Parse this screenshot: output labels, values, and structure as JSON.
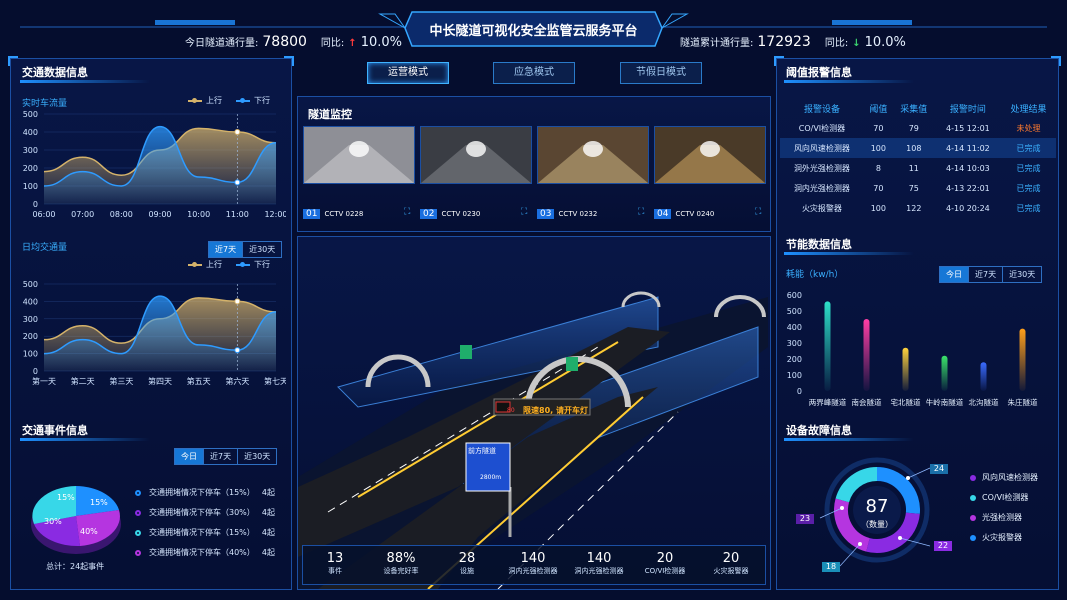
{
  "header": {
    "title": "中长隧道可视化安全监管云服务平台",
    "today_label": "今日隧道通行量:",
    "today_value": "78800",
    "today_yoy_label": "同比:",
    "today_yoy_arrow": "↑",
    "today_yoy_value": "10.0%",
    "total_label": "隧道累计通行量:",
    "total_value": "172923",
    "total_yoy_label": "同比:",
    "total_yoy_arrow": "↓",
    "total_yoy_value": "10.0%",
    "colors": {
      "up": "#ff3b3b",
      "down": "#3bd16f"
    }
  },
  "modes": [
    {
      "label": "运营模式",
      "active": true
    },
    {
      "label": "应急模式",
      "active": false
    },
    {
      "label": "节假日模式",
      "active": false
    }
  ],
  "traffic_info": {
    "title": "交通数据信息",
    "realtime": {
      "label": "实时车流量",
      "legend_up": "上行",
      "legend_down": "下行",
      "y_ticks": [
        "500",
        "400",
        "300",
        "200",
        "100",
        "0"
      ],
      "x_ticks": [
        "06:00",
        "07:00",
        "08:00",
        "09:00",
        "10:00",
        "11:00",
        "12:00"
      ]
    },
    "daily": {
      "label": "日均交通量",
      "tabs": [
        "近7天",
        "近30天"
      ],
      "legend_up": "上行",
      "legend_down": "下行",
      "y_ticks": [
        "500",
        "400",
        "300",
        "200",
        "100",
        "0"
      ],
      "x_ticks": [
        "第一天",
        "第二天",
        "第三天",
        "第四天",
        "第五天",
        "第六天",
        "第七天"
      ]
    }
  },
  "events": {
    "title": "交通事件信息",
    "tabs": [
      "今日",
      "近7天",
      "近30天"
    ],
    "pie_labels": [
      "15%",
      "15%",
      "30%",
      "40%"
    ],
    "items": [
      {
        "text": "交通拥堵情况下停车（15%）",
        "count": "4起",
        "color": "#1e90ff"
      },
      {
        "text": "交通拥堵情况下停车（30%）",
        "count": "4起",
        "color": "#8a2be2"
      },
      {
        "text": "交通拥堵情况下停车（15%）",
        "count": "4起",
        "color": "#37d7e8"
      },
      {
        "text": "交通拥堵情况下停车（40%）",
        "count": "4起",
        "color": "#b535e0"
      }
    ],
    "total": "总计：24起事件"
  },
  "monitor": {
    "title": "隧道监控",
    "cams": [
      {
        "num": "01",
        "name": "CCTV 0228"
      },
      {
        "num": "02",
        "name": "CCTV 0230"
      },
      {
        "num": "03",
        "name": "CCTV 0232"
      },
      {
        "num": "04",
        "name": "CCTV 0240"
      }
    ]
  },
  "scene": {
    "sign_text": "限速80, 请开车灯",
    "sign_num": "80",
    "board_title": "前方隧道",
    "board_dist": "2800m"
  },
  "stats": [
    {
      "value": "13",
      "label": "事件"
    },
    {
      "value": "88%",
      "label": "设备完好率"
    },
    {
      "value": "28",
      "label": "设施"
    },
    {
      "value": "140",
      "label": "洞内光强检测器"
    },
    {
      "value": "140",
      "label": "洞内光强检测器"
    },
    {
      "value": "20",
      "label": "CO/VI检测器"
    },
    {
      "value": "20",
      "label": "火灾报警器"
    }
  ],
  "alarm": {
    "title": "阈值报警信息",
    "headers": [
      "报警设备",
      "阈值",
      "采集值",
      "报警时间",
      "处理结果"
    ],
    "rows": [
      {
        "device": "CO/VI检测器",
        "threshold": "70",
        "value": "79",
        "time": "4-15  12:01",
        "result": "未处理",
        "color": "#ff7a2e"
      },
      {
        "device": "风向风速检测器",
        "threshold": "100",
        "value": "108",
        "time": "4-14  11:02",
        "result": "已完成",
        "color": "#3ab0ff"
      },
      {
        "device": "洞外光强检测器",
        "threshold": "8",
        "value": "11",
        "time": "4-14  10:03",
        "result": "已完成",
        "color": "#3ab0ff"
      },
      {
        "device": "洞内光强检测器",
        "threshold": "70",
        "value": "75",
        "time": "4-13  22:01",
        "result": "已完成",
        "color": "#3ab0ff"
      },
      {
        "device": "火灾报警器",
        "threshold": "100",
        "value": "122",
        "time": "4-10  20:24",
        "result": "已完成",
        "color": "#3ab0ff"
      }
    ]
  },
  "energy": {
    "title": "节能数据信息",
    "unit_label": "耗能（kw/h）",
    "tabs": [
      "今日",
      "近7天",
      "近30天"
    ],
    "y_ticks": [
      "600",
      "500",
      "400",
      "300",
      "200",
      "100",
      "0"
    ]
  },
  "chart_data": [
    {
      "type": "area",
      "title": "实时车流量",
      "categories": [
        "06:00",
        "07:00",
        "08:00",
        "09:00",
        "10:00",
        "11:00",
        "12:00"
      ],
      "ylim": [
        0,
        500
      ],
      "series": [
        {
          "name": "上行",
          "values": [
            180,
            260,
            160,
            300,
            420,
            400,
            340
          ],
          "color": "#d4b26a"
        },
        {
          "name": "下行",
          "values": [
            100,
            180,
            100,
            430,
            150,
            120,
            340
          ],
          "color": "#2e9bff"
        }
      ]
    },
    {
      "type": "area",
      "title": "日均交通量",
      "categories": [
        "第一天",
        "第二天",
        "第三天",
        "第四天",
        "第五天",
        "第六天",
        "第七天"
      ],
      "ylim": [
        0,
        500
      ],
      "series": [
        {
          "name": "上行",
          "values": [
            180,
            260,
            160,
            300,
            420,
            400,
            340
          ],
          "color": "#d4b26a"
        },
        {
          "name": "下行",
          "values": [
            100,
            180,
            100,
            430,
            150,
            120,
            340
          ],
          "color": "#2e9bff"
        }
      ]
    },
    {
      "type": "pie",
      "title": "交通事件信息",
      "categories": [
        "交通拥堵情况下停车（15%）",
        "交通拥堵情况下停车（30%）",
        "交通拥堵情况下停车（15%）",
        "交通拥堵情况下停车（40%）"
      ],
      "values": [
        15,
        30,
        15,
        40
      ]
    },
    {
      "type": "bar",
      "title": "节能数据信息",
      "ylabel": "耗能（kw/h）",
      "categories": [
        "两界峰隧道",
        "南会隧道",
        "宅北隧道",
        "牛岭南隧道",
        "北沟隧道",
        "朱庄隧道"
      ],
      "values": [
        560,
        450,
        270,
        220,
        180,
        390
      ],
      "colors": [
        "#2de0c8",
        "#ff3ea5",
        "#ffd33d",
        "#3be36a",
        "#3a6bff",
        "#ff9f1a"
      ],
      "ylim": [
        0,
        600
      ]
    },
    {
      "type": "pie",
      "title": "设备故障信息",
      "center_value": "87",
      "center_label": "（数量）",
      "categories": [
        "风向风速检测器",
        "CO/VI检测器",
        "光强检测器",
        "火灾报警器"
      ],
      "values": [
        24,
        18,
        22,
        23
      ],
      "colors": [
        "#8a2be2",
        "#37d7e8",
        "#b535e0",
        "#1e90ff"
      ]
    }
  ],
  "fault": {
    "title": "设备故障信息",
    "center_value": "87",
    "center_label": "（数量）",
    "callouts": [
      "24",
      "22",
      "18",
      "23"
    ],
    "legend": [
      {
        "label": "风向风速检测器",
        "color": "#8a2be2"
      },
      {
        "label": "CO/VI检测器",
        "color": "#37d7e8"
      },
      {
        "label": "光强检测器",
        "color": "#b535e0"
      },
      {
        "label": "火灾报警器",
        "color": "#1e90ff"
      }
    ]
  }
}
